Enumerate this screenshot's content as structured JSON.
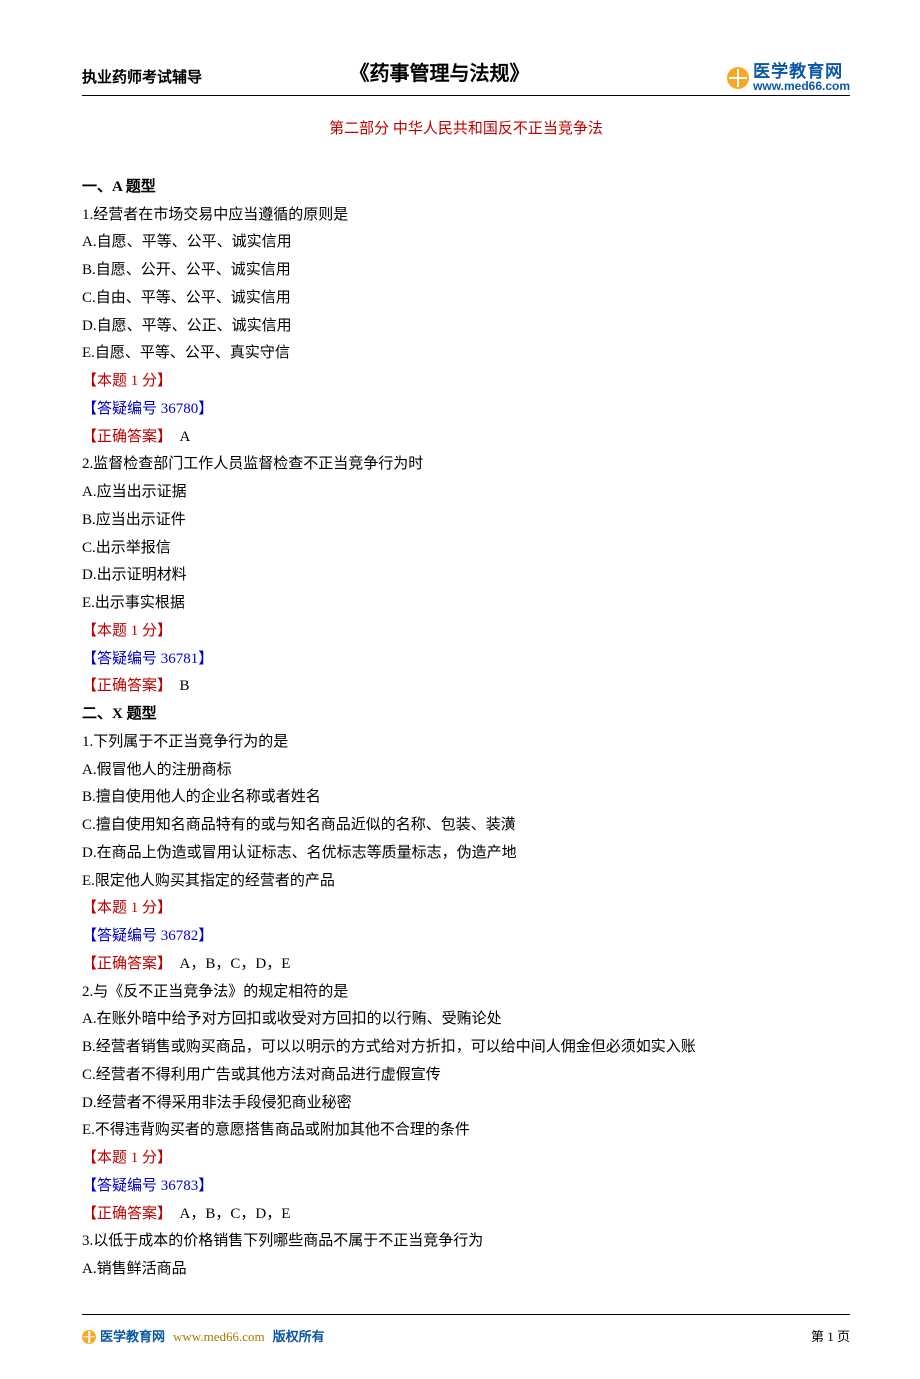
{
  "header": {
    "left": "执业药师考试辅导",
    "center": "《药事管理与法规》",
    "logo_cn": "医学教育网",
    "logo_url": "www.med66.com"
  },
  "section_title": "第二部分 中华人民共和国反不正当竞争法",
  "sectionA": {
    "heading": "一、A 题型",
    "q1": {
      "stem": "1.经营者在市场交易中应当遵循的原则是",
      "a": "A.自愿、平等、公平、诚实信用",
      "b": "B.自愿、公开、公平、诚实信用",
      "c": "C.自由、平等、公平、诚实信用",
      "d": "D.自愿、平等、公正、诚实信用",
      "e": "E.自愿、平等、公平、真实守信",
      "score": "【本题 1 分】",
      "ref": "【答疑编号 36780】",
      "ans_label": "【正确答案】",
      "ans": "　A"
    },
    "q2": {
      "stem": "2.监督检查部门工作人员监督检查不正当竞争行为时",
      "a": "A.应当出示证据",
      "b": "B.应当出示证件",
      "c": "C.出示举报信",
      "d": "D.出示证明材料",
      "e": "E.出示事实根据",
      "score": "【本题 1 分】",
      "ref": "【答疑编号 36781】",
      "ans_label": "【正确答案】",
      "ans": "　B"
    }
  },
  "sectionX": {
    "heading": "二、X 题型",
    "q1": {
      "stem": "1.下列属于不正当竞争行为的是",
      "a": "A.假冒他人的注册商标",
      "b": "B.擅自使用他人的企业名称或者姓名",
      "c": "C.擅自使用知名商品特有的或与知名商品近似的名称、包装、装潢",
      "d": "D.在商品上伪造或冒用认证标志、名优标志等质量标志，伪造产地",
      "e": "E.限定他人购买其指定的经营者的产品",
      "score": "【本题 1 分】",
      "ref": "【答疑编号 36782】",
      "ans_label": "【正确答案】",
      "ans": "　A，B，C，D，E"
    },
    "q2": {
      "stem": "2.与《反不正当竞争法》的规定相符的是",
      "a": "A.在账外暗中给予对方回扣或收受对方回扣的以行贿、受贿论处",
      "b": "B.经营者销售或购买商品，可以以明示的方式给对方折扣，可以给中间人佣金但必须如实入账",
      "c": "C.经营者不得利用广告或其他方法对商品进行虚假宣传",
      "d": "D.经营者不得采用非法手段侵犯商业秘密",
      "e": "E.不得违背购买者的意愿搭售商品或附加其他不合理的条件",
      "score": "【本题 1 分】",
      "ref": "【答疑编号 36783】",
      "ans_label": "【正确答案】",
      "ans": "　A，B，C，D，E"
    },
    "q3": {
      "stem": "3.以低于成本的价格销售下列哪些商品不属于不正当竞争行为",
      "a": "A.销售鲜活商品"
    }
  },
  "footer": {
    "brand": "医学教育网",
    "url": "www.med66.com",
    "copy": "版权所有",
    "page": "第 1 页"
  }
}
